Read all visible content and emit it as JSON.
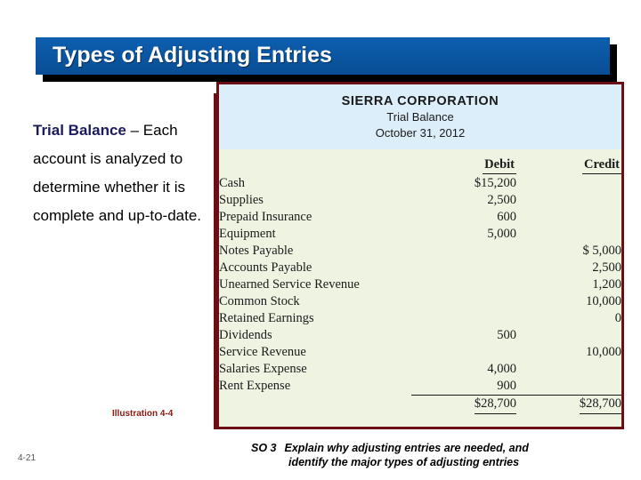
{
  "slide": {
    "title": "Types of Adjusting Entries",
    "page_number": "4-21",
    "illustration_caption": "Illustration 4-4"
  },
  "left_note": {
    "term": "Trial Balance",
    "body": " – Each account is analyzed to determine whether it is complete and up-to-date."
  },
  "footer": {
    "so_label": "SO 3",
    "objective_line1": "Explain why adjusting entries are needed, and",
    "objective_line2": "identify the major types of adjusting entries"
  },
  "trial_balance": {
    "company": "SIERRA CORPORATION",
    "statement": "Trial Balance",
    "date": "October 31, 2012",
    "columns": [
      "Debit",
      "Credit"
    ],
    "rows": [
      {
        "account": "Cash",
        "debit": "$15,200",
        "credit": ""
      },
      {
        "account": "Supplies",
        "debit": "2,500",
        "credit": ""
      },
      {
        "account": "Prepaid Insurance",
        "debit": "600",
        "credit": ""
      },
      {
        "account": "Equipment",
        "debit": "5,000",
        "credit": ""
      },
      {
        "account": "Notes Payable",
        "debit": "",
        "credit": "$ 5,000"
      },
      {
        "account": "Accounts Payable",
        "debit": "",
        "credit": "2,500"
      },
      {
        "account": "Unearned Service Revenue",
        "debit": "",
        "credit": "1,200"
      },
      {
        "account": "Common Stock",
        "debit": "",
        "credit": "10,000"
      },
      {
        "account": "Retained Earnings",
        "debit": "",
        "credit": "0"
      },
      {
        "account": "Dividends",
        "debit": "500",
        "credit": ""
      },
      {
        "account": "Service Revenue",
        "debit": "",
        "credit": "10,000"
      },
      {
        "account": "Salaries Expense",
        "debit": "4,000",
        "credit": ""
      },
      {
        "account": "Rent Expense",
        "debit": "900",
        "credit": ""
      }
    ],
    "totals": {
      "account": "",
      "debit": "$28,700",
      "credit": "$28,700"
    }
  },
  "colors": {
    "banner_blue": "#0a57a4",
    "figure_border": "#6b0f14",
    "figure_header_bg": "#ddeefb",
    "figure_body_bg": "#eef3e2",
    "caption_red": "#8b1a14",
    "term_navy": "#1b1b5e"
  }
}
